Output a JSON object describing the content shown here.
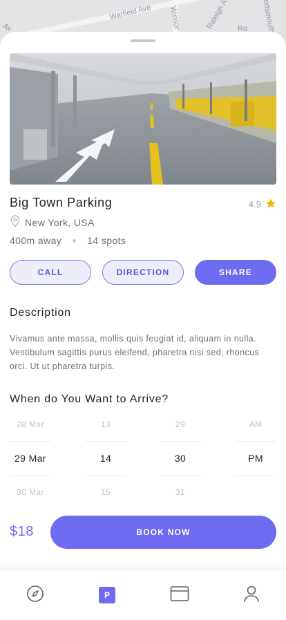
{
  "map": {
    "streets": [
      "Warfield Ave",
      "Winsor",
      "Raleigh Ave",
      "Portsmouth",
      "Rd",
      "Av"
    ]
  },
  "parking": {
    "name": "Big Town Parking",
    "rating": "4.9",
    "location": "New York, USA",
    "distance": "400m away",
    "spots": "14 spots"
  },
  "actions": {
    "call": "CALL",
    "direction": "DIRECTION",
    "share": "SHARE"
  },
  "description": {
    "heading": "Description",
    "text": "Vivamus ante massa, mollis quis feugiat id, aliquam in nulla. Vestibulum sagittis purus eleifend, pharetra nisi sed, rhoncus orci. Ut ut pharetra turpis."
  },
  "arrival": {
    "heading": "When do You Want to Arrive?",
    "date": [
      "28 Mar",
      "29 Mar",
      "30 Mar"
    ],
    "hour": [
      "13",
      "14",
      "15"
    ],
    "minute": [
      "29",
      "30",
      "31"
    ],
    "period": [
      "AM",
      "PM",
      ""
    ]
  },
  "booking": {
    "price": "$18",
    "button": "BOOK NOW"
  },
  "tabs": {
    "parking_badge": "P"
  },
  "colors": {
    "accent": "#6e6bf1",
    "star": "#f5b400"
  },
  "icons": [
    "location-pin-icon",
    "star-icon",
    "compass-icon",
    "parking-icon",
    "wallet-icon",
    "user-icon"
  ]
}
